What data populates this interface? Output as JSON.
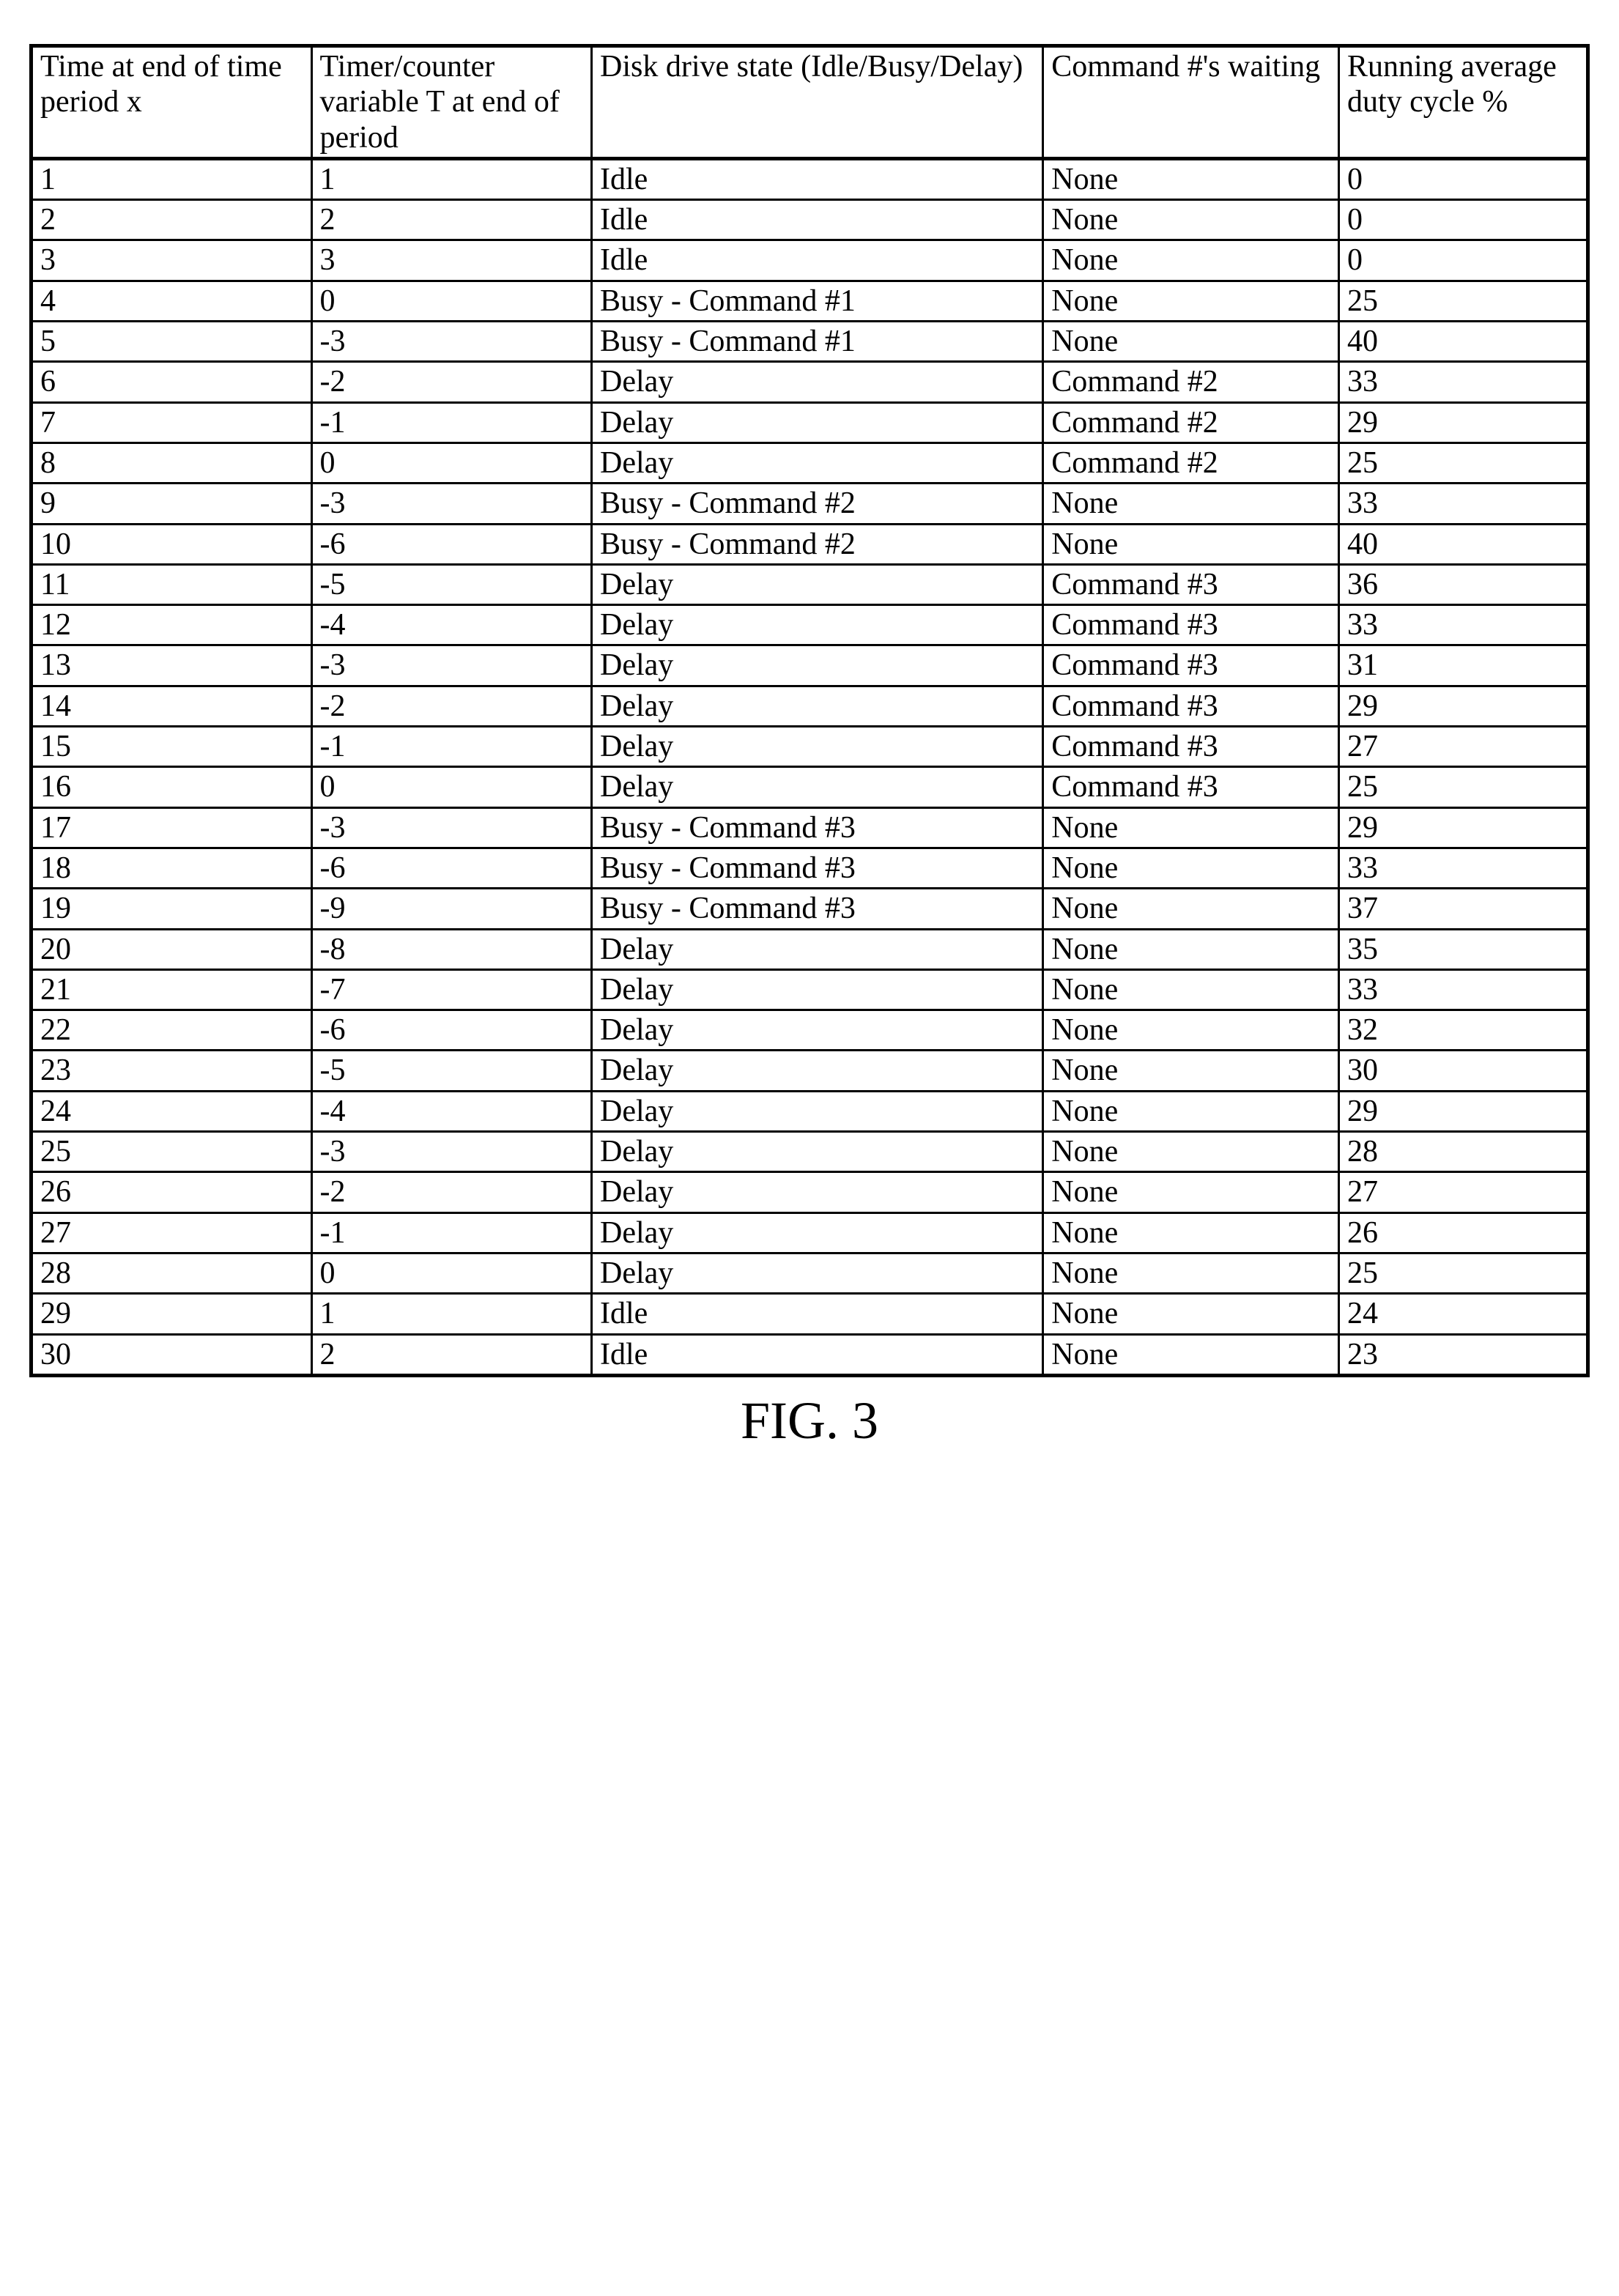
{
  "table": {
    "headers": [
      "Time at end of time period x",
      "Timer/counter variable T at end of period",
      "Disk drive state (Idle/Busy/Delay)",
      "Command #'s waiting",
      "Running average duty cycle %"
    ],
    "rows": [
      {
        "time": "1",
        "t": "1",
        "state": "Idle",
        "waiting": "None",
        "duty": "0"
      },
      {
        "time": "2",
        "t": "2",
        "state": "Idle",
        "waiting": "None",
        "duty": "0"
      },
      {
        "time": "3",
        "t": "3",
        "state": "Idle",
        "waiting": "None",
        "duty": "0"
      },
      {
        "time": "4",
        "t": "0",
        "state": "Busy - Command #1",
        "waiting": "None",
        "duty": "25"
      },
      {
        "time": "5",
        "t": "-3",
        "state": "Busy - Command #1",
        "waiting": "None",
        "duty": "40"
      },
      {
        "time": "6",
        "t": "-2",
        "state": "Delay",
        "waiting": "Command #2",
        "duty": "33"
      },
      {
        "time": "7",
        "t": "-1",
        "state": "Delay",
        "waiting": "Command #2",
        "duty": "29"
      },
      {
        "time": "8",
        "t": "0",
        "state": "Delay",
        "waiting": "Command #2",
        "duty": "25"
      },
      {
        "time": "9",
        "t": "-3",
        "state": "Busy - Command #2",
        "waiting": "None",
        "duty": "33"
      },
      {
        "time": "10",
        "t": "-6",
        "state": "Busy - Command #2",
        "waiting": "None",
        "duty": "40"
      },
      {
        "time": "11",
        "t": "-5",
        "state": "Delay",
        "waiting": "Command #3",
        "duty": "36"
      },
      {
        "time": "12",
        "t": "-4",
        "state": "Delay",
        "waiting": "Command #3",
        "duty": "33"
      },
      {
        "time": "13",
        "t": "-3",
        "state": "Delay",
        "waiting": "Command #3",
        "duty": "31"
      },
      {
        "time": "14",
        "t": "-2",
        "state": "Delay",
        "waiting": "Command #3",
        "duty": "29"
      },
      {
        "time": "15",
        "t": "-1",
        "state": "Delay",
        "waiting": "Command #3",
        "duty": "27"
      },
      {
        "time": "16",
        "t": "0",
        "state": "Delay",
        "waiting": "Command #3",
        "duty": "25"
      },
      {
        "time": "17",
        "t": "-3",
        "state": "Busy - Command #3",
        "waiting": "None",
        "duty": "29"
      },
      {
        "time": "18",
        "t": "-6",
        "state": "Busy - Command #3",
        "waiting": "None",
        "duty": "33"
      },
      {
        "time": "19",
        "t": "-9",
        "state": "Busy - Command #3",
        "waiting": "None",
        "duty": "37"
      },
      {
        "time": "20",
        "t": "-8",
        "state": "Delay",
        "waiting": "None",
        "duty": "35"
      },
      {
        "time": "21",
        "t": "-7",
        "state": "Delay",
        "waiting": "None",
        "duty": "33"
      },
      {
        "time": "22",
        "t": "-6",
        "state": "Delay",
        "waiting": "None",
        "duty": "32"
      },
      {
        "time": "23",
        "t": "-5",
        "state": "Delay",
        "waiting": "None",
        "duty": "30"
      },
      {
        "time": "24",
        "t": "-4",
        "state": "Delay",
        "waiting": "None",
        "duty": "29"
      },
      {
        "time": "25",
        "t": "-3",
        "state": "Delay",
        "waiting": "None",
        "duty": "28"
      },
      {
        "time": "26",
        "t": "-2",
        "state": "Delay",
        "waiting": "None",
        "duty": "27"
      },
      {
        "time": "27",
        "t": "-1",
        "state": "Delay",
        "waiting": "None",
        "duty": "26"
      },
      {
        "time": "28",
        "t": "0",
        "state": "Delay",
        "waiting": "None",
        "duty": "25"
      },
      {
        "time": "29",
        "t": "1",
        "state": "Idle",
        "waiting": "None",
        "duty": "24"
      },
      {
        "time": "30",
        "t": "2",
        "state": "Idle",
        "waiting": "None",
        "duty": "23"
      }
    ]
  },
  "caption": "FIG. 3"
}
